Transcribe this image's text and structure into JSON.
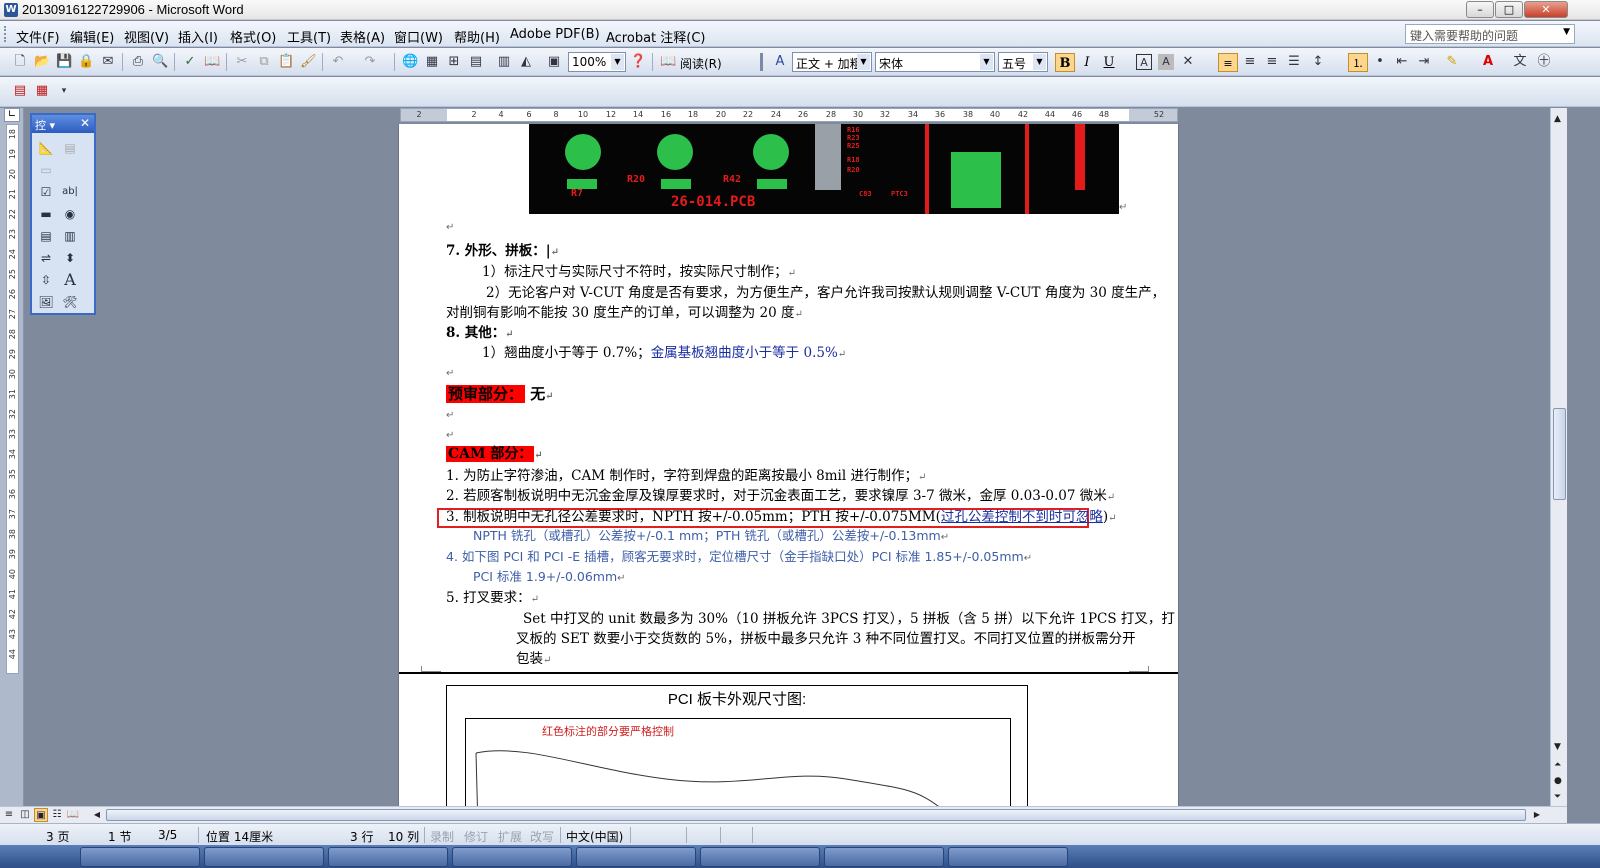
{
  "window": {
    "title": "20130916122729906 - Microsoft Word",
    "buttons": {
      "minimize": "–",
      "maximize": "□",
      "close": "✕"
    }
  },
  "menu": {
    "items": [
      "文件(F)",
      "编辑(E)",
      "视图(V)",
      "插入(I)",
      "格式(O)",
      "工具(T)",
      "表格(A)",
      "窗口(W)",
      "帮助(H)",
      "Adobe PDF(B)",
      "Acrobat 注释(C)"
    ],
    "help_placeholder": "键入需要帮助的问题"
  },
  "toolbar": {
    "zoom": "100%",
    "read_label": "阅读(R)",
    "style": "正文 + 加粗",
    "font": "宋体",
    "size": "五号",
    "bold": "B",
    "italic": "I",
    "underline": "U"
  },
  "toolbox": {
    "title": "控"
  },
  "ruler": {
    "h_ticks": [
      "2",
      "2",
      "4",
      "6",
      "8",
      "10",
      "12",
      "14",
      "16",
      "18",
      "20",
      "22",
      "24",
      "26",
      "28",
      "30",
      "32",
      "34",
      "36",
      "38",
      "40",
      "42",
      "44",
      "46",
      "48",
      "52"
    ],
    "v_ticks": [
      "18",
      "19",
      "20",
      "21",
      "22",
      "23",
      "24",
      "25",
      "26",
      "27",
      "28",
      "29",
      "30",
      "31",
      "32",
      "33",
      "34",
      "35",
      "36",
      "37",
      "38",
      "39",
      "40",
      "41",
      "42",
      "43",
      "44"
    ]
  },
  "pcb": {
    "labels": [
      "R7",
      "R20",
      "R42",
      "26-014.PCB",
      "R16",
      "R23",
      "R25",
      "R18",
      "R20",
      "C83",
      "PTC3"
    ]
  },
  "doc": {
    "l1": "7.   外形、拼板：",
    "l2": "1）标注尺寸与实际尺寸不符时，按实际尺寸制作；",
    "l3": "2）无论客户对 V-CUT 角度是否有要求，为方便生产，客户允许我司按默认规则调整 V-CUT 角度为 30 度生产，",
    "l4": "对削铜有影响不能按 30 度生产的订单，可以调整为 20 度",
    "l5": "8.   其他：",
    "l6a": "1）翘曲度小于等于 0.7%；",
    "l6b": "金属基板翘曲度小于等于 0.5%",
    "precheck": "预审部分：",
    "precheck_val": "无",
    "cam": "CAM 部分：",
    "c1": "1.   为防止字符渗油，CAM 制作时，字符到焊盘的距离按最小 8mil 进行制作；",
    "c2": "2.   若顾客制板说明中无沉金金厚及镍厚要求时，对于沉金表面工艺，要求镍厚 3-7 微米，金厚 0.03-0.07 微米",
    "c3a": "3.   制板说明中无孔径公差要求时，NPTH 按+/-0.05mm；PTH 按+/-0.075MM(",
    "c3b": "过孔公差控制不到时可忽略",
    "c3c": ")",
    "c3d": "NPTH 铣孔（或槽孔）公差按+/-0.1 mm；PTH 铣孔（或槽孔）公差按+/-0.13mm",
    "c4": "4.   如下图 PCI 和 PCI -E 插槽，顾客无要求时，定位槽尺寸（金手指缺口处）PCI 标准 1.85+/-0.05mm",
    "c4b": "PCI 标准 1.9+/-0.06mm",
    "c5": "5. 打叉要求：",
    "c5a": "Set 中打叉的 unit 数最多为 30%（10 拼板允许 3PCS 打叉），5 拼板（含 5 拼）以下允许 1PCS 打叉，打",
    "c5b": "叉板的 SET 数要小于交货数的 5%，拼板中最多只允许 3 种不同位置打叉。不同打叉位置的拼板需分开",
    "c5c": "包装",
    "fig_title": "PCI 板卡外观尺寸图:",
    "fig_note": "红色标注的部分要严格控制"
  },
  "status": {
    "page": "3 页",
    "section": "1 节",
    "pages": "3/5",
    "pos": "位置 14厘米",
    "line": "3 行",
    "col": "10 列",
    "rec": "录制",
    "trk": "修订",
    "ext": "扩展",
    "ovr": "改写",
    "lang": "中文(中国)"
  },
  "colors": {
    "highlight": "#ff0000",
    "redbox": "#e02020",
    "blue_text": "#1a2fa0",
    "pcb_green": "#2cc04a",
    "pcb_red": "#e41b1b"
  }
}
